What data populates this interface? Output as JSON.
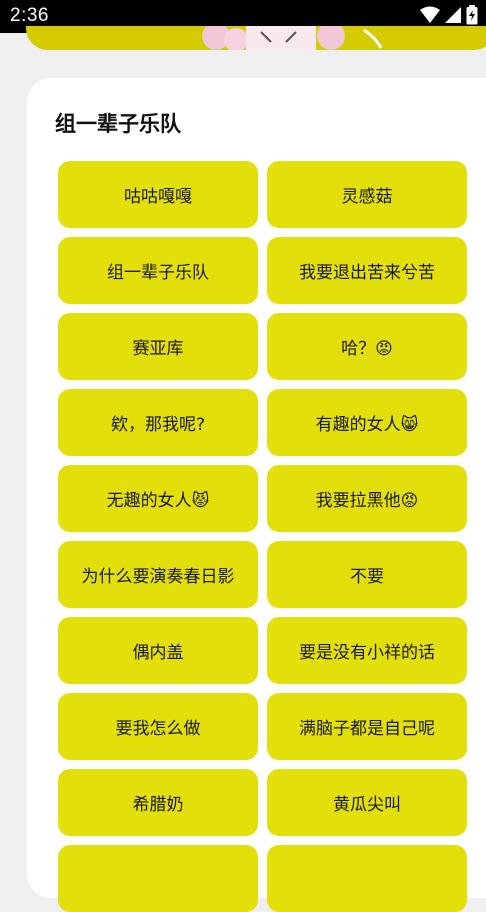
{
  "status_bar": {
    "time": "2:36",
    "icons": [
      "wifi-icon",
      "signal-icon",
      "battery-charging-icon"
    ]
  },
  "card": {
    "title": "组一辈子乐队",
    "buttons": [
      "咕咕嘎嘎",
      "灵感菇",
      "组一辈子乐队",
      "我要退出苦来兮苦",
      "赛亚库",
      "哈？😡",
      "欸，那我呢?",
      "有趣的女人😸",
      "无趣的女人😾",
      "我要拉黑他😡",
      "为什么要演奏春日影",
      "不要",
      "偶内盖",
      "要是没有小祥的话",
      "要我怎么做",
      "满脑子都是自己呢",
      "希腊奶",
      "黄瓜尖叫",
      "",
      ""
    ]
  },
  "colors": {
    "button_bg": "#e3df0b",
    "banner_bg": "#d5cb00",
    "page_bg": "#efefef"
  }
}
